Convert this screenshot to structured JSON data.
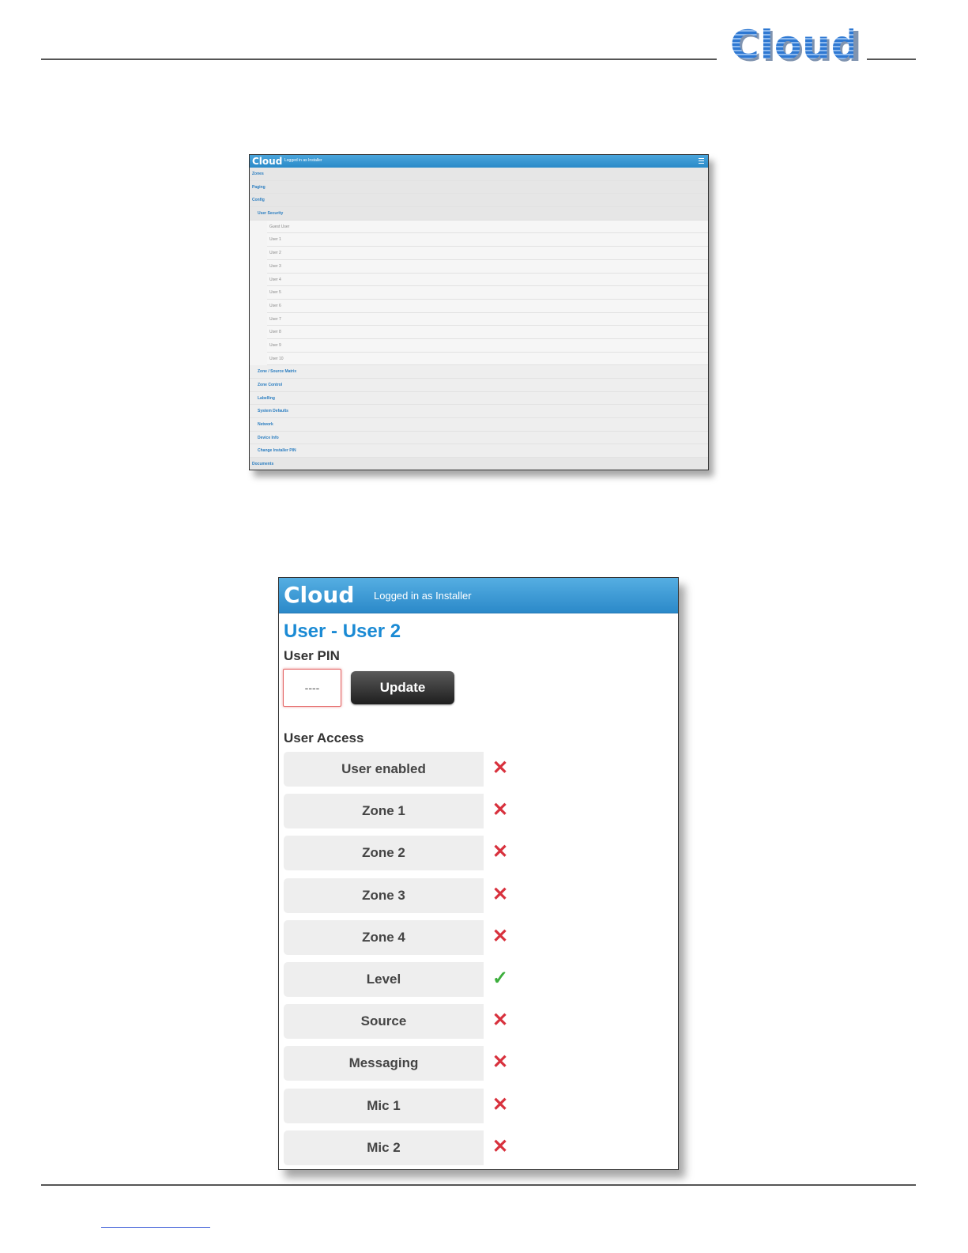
{
  "document": {
    "brand_logo": "Cloud"
  },
  "menu_screen": {
    "header": {
      "logo": "Cloud",
      "logged_in_text": "Logged in as Installer",
      "menu_icon": "hamburger-icon"
    },
    "rows": [
      {
        "label": "Zones",
        "level": 0
      },
      {
        "label": "Paging",
        "level": 0
      },
      {
        "label": "Config",
        "level": 0
      },
      {
        "label": "User Security",
        "level": 1,
        "open": true
      },
      {
        "label": "Guest User",
        "level": 2
      },
      {
        "label": "User 1",
        "level": 2
      },
      {
        "label": "User 2",
        "level": 2
      },
      {
        "label": "User 3",
        "level": 2
      },
      {
        "label": "User 4",
        "level": 2
      },
      {
        "label": "User 5",
        "level": 2
      },
      {
        "label": "User 6",
        "level": 2
      },
      {
        "label": "User 7",
        "level": 2
      },
      {
        "label": "User 8",
        "level": 2
      },
      {
        "label": "User 9",
        "level": 2
      },
      {
        "label": "User 10",
        "level": 2
      },
      {
        "label": "Zone / Source Matrix",
        "level": 1
      },
      {
        "label": "Zone Control",
        "level": 1
      },
      {
        "label": "Labelling",
        "level": 1
      },
      {
        "label": "System Defaults",
        "level": 1
      },
      {
        "label": "Network",
        "level": 1
      },
      {
        "label": "Device Info",
        "level": 1
      },
      {
        "label": "Change Installer PIN",
        "level": 1
      },
      {
        "label": "Documents",
        "level": 0
      }
    ]
  },
  "user_screen": {
    "header": {
      "logo": "Cloud",
      "logged_in_text": "Logged in as Installer"
    },
    "title": "User - User 2",
    "pin_label": "User PIN",
    "pin_value": "----",
    "update_label": "Update",
    "access_label": "User Access",
    "access_items": [
      {
        "label": "User enabled",
        "enabled": false,
        "icon": "cross-icon",
        "mark": "✕"
      },
      {
        "label": "Zone 1",
        "enabled": false,
        "icon": "cross-icon",
        "mark": "✕"
      },
      {
        "label": "Zone 2",
        "enabled": false,
        "icon": "cross-icon",
        "mark": "✕"
      },
      {
        "label": "Zone 3",
        "enabled": false,
        "icon": "cross-icon",
        "mark": "✕"
      },
      {
        "label": "Zone 4",
        "enabled": false,
        "icon": "cross-icon",
        "mark": "✕"
      },
      {
        "label": "Level",
        "enabled": true,
        "icon": "check-icon",
        "mark": "✓"
      },
      {
        "label": "Source",
        "enabled": false,
        "icon": "cross-icon",
        "mark": "✕"
      },
      {
        "label": "Messaging",
        "enabled": false,
        "icon": "cross-icon",
        "mark": "✕"
      },
      {
        "label": "Mic 1",
        "enabled": false,
        "icon": "cross-icon",
        "mark": "✕"
      },
      {
        "label": "Mic 2",
        "enabled": false,
        "icon": "cross-icon",
        "mark": "✕"
      }
    ],
    "colors": {
      "enabled": "#3cae3c",
      "disabled": "#d8313d",
      "accent": "#1a8ad4"
    }
  }
}
